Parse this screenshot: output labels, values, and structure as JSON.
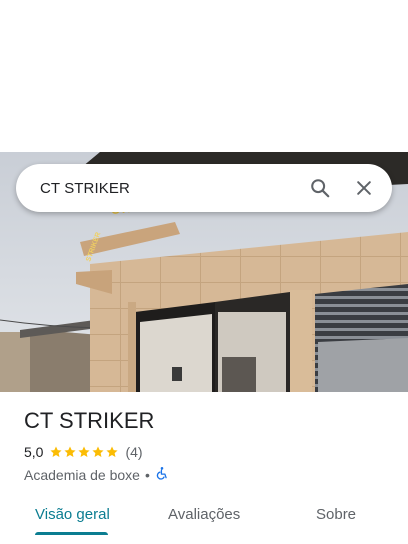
{
  "search": {
    "query": "CT STRIKER"
  },
  "icons": {
    "search": "search-icon",
    "close": "close-icon",
    "accessibility": "wheelchair-icon",
    "star": "star-icon"
  },
  "photo": {
    "building_sign_lines": [
      "STRIKER",
      "ACADEMIA DE"
    ],
    "small_sign": "STRIKER"
  },
  "place": {
    "name": "CT STRIKER",
    "rating": "5,0",
    "stars": 5,
    "review_count": "(4)",
    "category": "Academia de boxe",
    "separator": "•"
  },
  "tabs": [
    {
      "label": "Visão geral",
      "active": true
    },
    {
      "label": "Avaliações",
      "active": false
    },
    {
      "label": "Sobre",
      "active": false
    }
  ],
  "colors": {
    "accent": "#0b7d91",
    "star": "#fbbc04",
    "text": "#202124",
    "secondary": "#5f6368",
    "accessibility": "#1a73e8"
  }
}
